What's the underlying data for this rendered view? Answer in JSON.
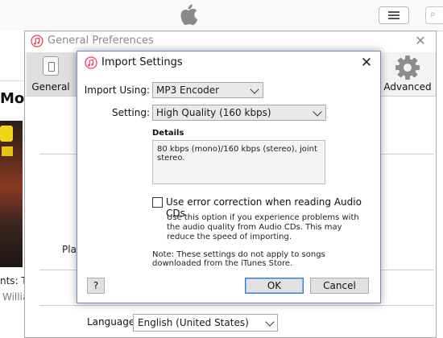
{
  "background": {
    "partial_title": "Mon",
    "partial_text_1": "nts: T",
    "partial_text_2": "Willia",
    "playback_partial": "Play"
  },
  "prefs_window": {
    "title": "General Preferences",
    "toolbar": {
      "general_label": "General",
      "advanced_label": "Advanced"
    },
    "language_label": "Language:",
    "language_value": "English (United States)"
  },
  "import_dialog": {
    "title": "Import Settings",
    "import_using_label": "Import Using:",
    "import_using_value": "MP3 Encoder",
    "setting_label": "Setting:",
    "setting_value": "High Quality (160 kbps)",
    "details_label": "Details",
    "details_text": "80 kbps (mono)/160 kbps (stereo), joint stereo.",
    "error_correction_label": "Use error correction when reading Audio CDs",
    "error_correction_checked": false,
    "error_correction_desc": "Use this option if you experience problems with the audio quality from Audio CDs.  This may reduce the speed of importing.",
    "note": "Note: These settings do not apply to songs downloaded from the iTunes Store.",
    "help_label": "?",
    "ok_label": "OK",
    "cancel_label": "Cancel"
  },
  "colors": {
    "accent": "#2c7cd3",
    "itunes_icon": "#e8455f"
  }
}
